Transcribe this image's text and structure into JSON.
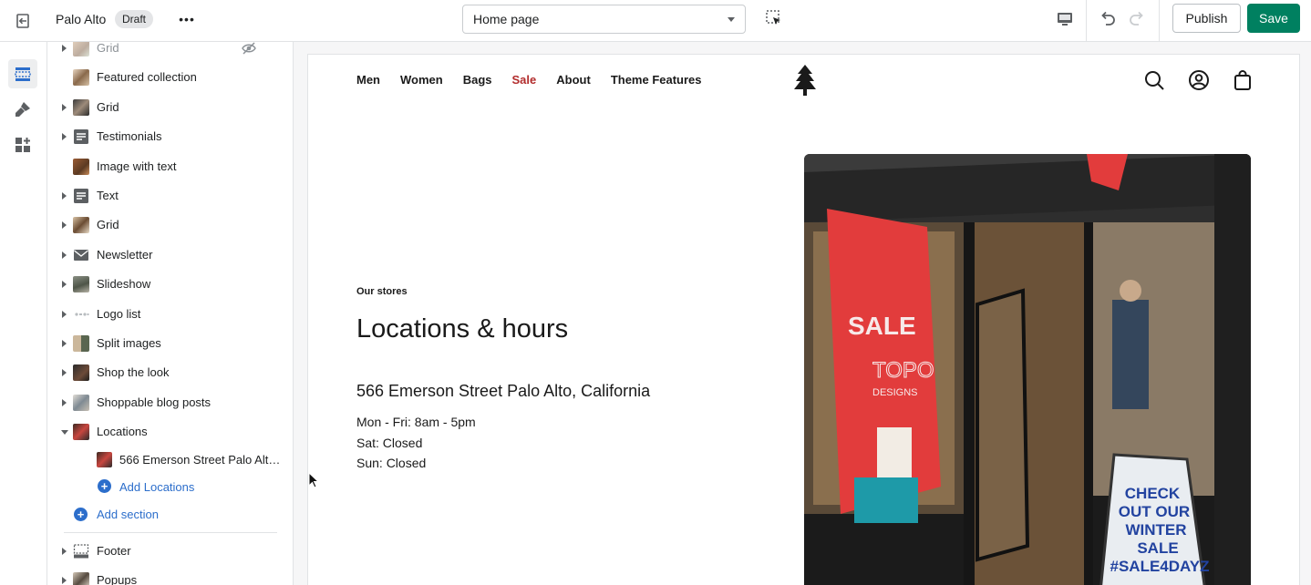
{
  "topbar": {
    "store_name": "Palo Alto",
    "status_badge": "Draft",
    "more_label": "•••",
    "page_select": "Home page",
    "publish_label": "Publish",
    "save_label": "Save"
  },
  "colors": {
    "accent": "#2c6ecb",
    "save_green": "#008060",
    "sale_red": "#b22c2c"
  },
  "rail": {
    "items": [
      {
        "icon": "sections-icon",
        "active": true
      },
      {
        "icon": "theme-settings-icon",
        "active": false
      },
      {
        "icon": "app-embeds-icon",
        "active": false
      }
    ]
  },
  "sidebar": {
    "sections": [
      {
        "label": "Grid",
        "icon": "image-thumbnail-icon",
        "expandable": true,
        "hidden": true
      },
      {
        "label": "Featured collection",
        "icon": "image-thumbnail-icon",
        "expandable": false
      },
      {
        "label": "Grid",
        "icon": "image-thumbnail-icon",
        "expandable": true
      },
      {
        "label": "Testimonials",
        "icon": "text-block-icon",
        "expandable": true
      },
      {
        "label": "Image with text",
        "icon": "image-thumbnail-icon",
        "expandable": false
      },
      {
        "label": "Text",
        "icon": "text-block-icon",
        "expandable": true
      },
      {
        "label": "Grid",
        "icon": "image-thumbnail-icon",
        "expandable": true
      },
      {
        "label": "Newsletter",
        "icon": "envelope-icon",
        "expandable": true
      },
      {
        "label": "Slideshow",
        "icon": "image-thumbnail-icon",
        "expandable": true
      },
      {
        "label": "Logo list",
        "icon": "logo-thumbnail-icon",
        "expandable": true
      },
      {
        "label": "Split images",
        "icon": "image-thumbnail-icon",
        "expandable": true
      },
      {
        "label": "Shop the look",
        "icon": "image-thumbnail-icon",
        "expandable": true
      },
      {
        "label": "Shoppable blog posts",
        "icon": "image-thumbnail-icon",
        "expandable": true
      },
      {
        "label": "Locations",
        "icon": "image-thumbnail-icon",
        "expandable": true,
        "expanded": true
      }
    ],
    "location_block": "566 Emerson Street Palo Alto, California",
    "add_block_label": "Add Locations",
    "add_section_label": "Add section",
    "footer_sections": [
      {
        "label": "Footer",
        "icon": "footer-icon"
      },
      {
        "label": "Popups",
        "icon": "image-thumbnail-icon"
      }
    ]
  },
  "preview": {
    "nav": [
      "Men",
      "Women",
      "Bags",
      "Sale",
      "About",
      "Theme Features"
    ],
    "eyebrow": "Our stores",
    "title": "Locations & hours",
    "address": "566 Emerson Street Palo Alto, California",
    "hours": [
      "Mon - Fri: 8am - 5pm",
      "Sat: Closed",
      "Sun: Closed"
    ],
    "sign_lines": [
      "CHECK",
      "OUT OUR",
      "WINTER",
      "SALE",
      "#SALE4DAYZ"
    ],
    "window_sale": "SALE",
    "window_brand": "TOPO",
    "window_brand2": "DESIGNS"
  }
}
